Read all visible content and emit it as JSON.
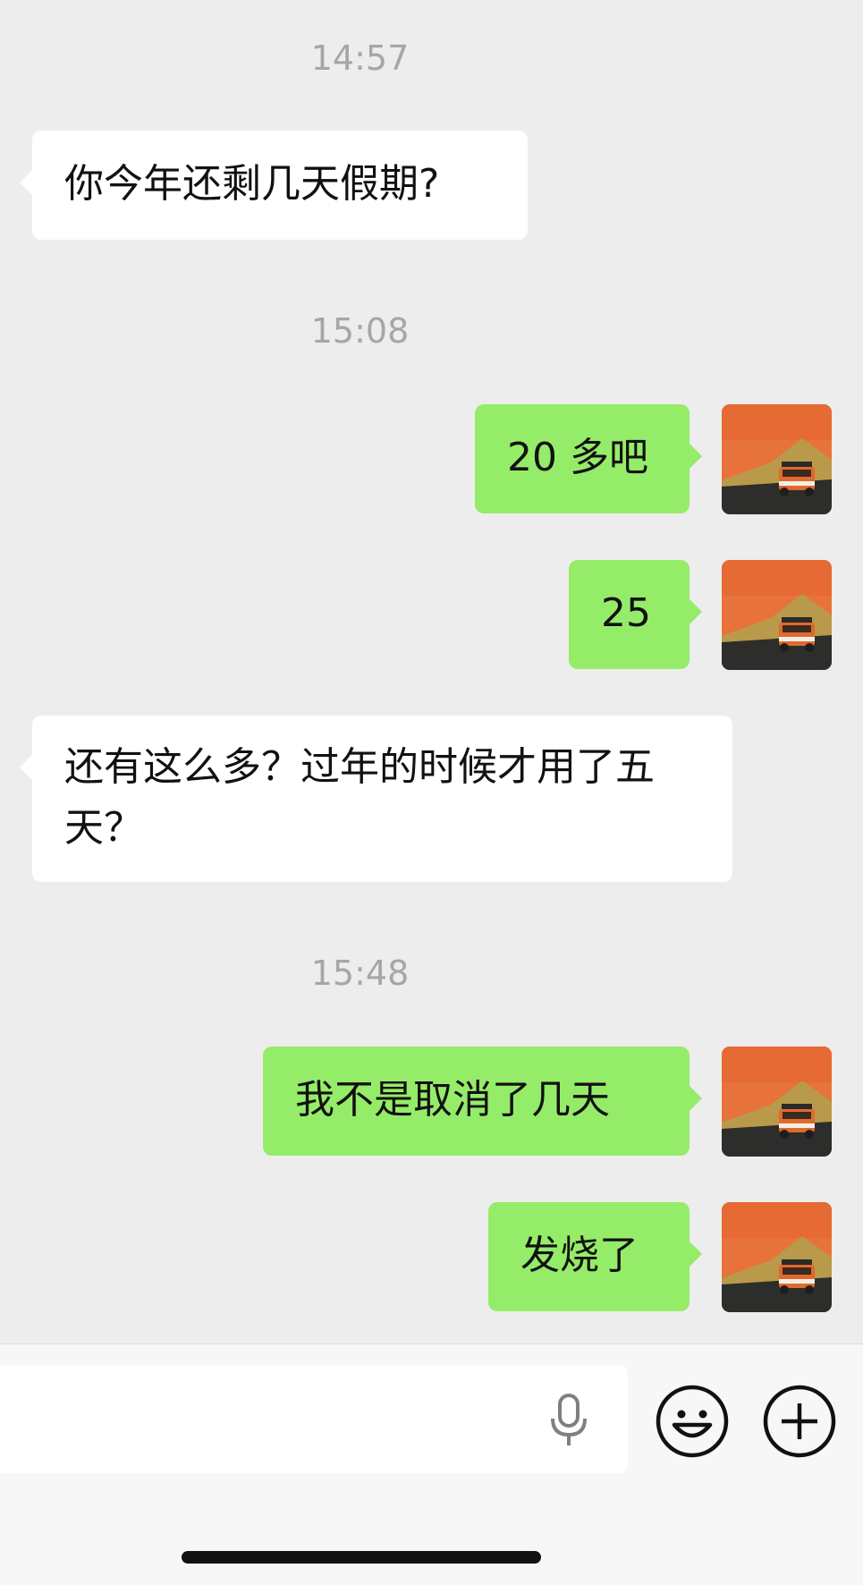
{
  "chat": {
    "messages": [
      {
        "type": "time",
        "text": "14:57"
      },
      {
        "type": "left",
        "text": "你今年还剩几天假期?"
      },
      {
        "type": "time",
        "text": "15:08"
      },
      {
        "type": "right",
        "text": "20 多吧"
      },
      {
        "type": "right",
        "text": "25"
      },
      {
        "type": "left",
        "text": "还有这么多？过年的时候才用了五天？"
      },
      {
        "type": "time",
        "text": "15:48"
      },
      {
        "type": "right",
        "text": "我不是取消了几天"
      },
      {
        "type": "right",
        "text": "发烧了"
      }
    ]
  },
  "input_bar": {
    "icons": [
      "microphone-icon",
      "emoji-icon",
      "plus-icon"
    ]
  },
  "colors": {
    "background": "#ededed",
    "bubble_sent": "#95ec69",
    "bubble_received": "#ffffff",
    "timestamp": "#a6a6a6"
  }
}
